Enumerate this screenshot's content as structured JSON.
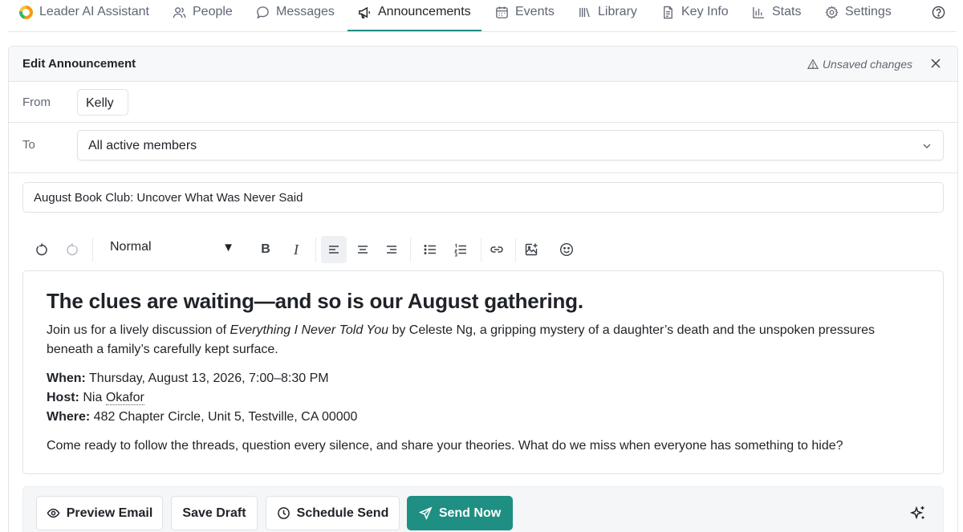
{
  "nav": {
    "brand": "Leader AI Assistant",
    "items": [
      {
        "label": "People",
        "icon": "people-icon"
      },
      {
        "label": "Messages",
        "icon": "message-bubble-icon"
      },
      {
        "label": "Announcements",
        "icon": "megaphone-icon"
      },
      {
        "label": "Events",
        "icon": "calendar-icon"
      },
      {
        "label": "Library",
        "icon": "library-icon"
      },
      {
        "label": "Key Info",
        "icon": "document-icon"
      },
      {
        "label": "Stats",
        "icon": "bar-chart-icon"
      },
      {
        "label": "Settings",
        "icon": "gear-icon"
      }
    ],
    "active": "Announcements",
    "accent_color": "#1e8f82"
  },
  "panel": {
    "title": "Edit Announcement",
    "status": "Unsaved changes"
  },
  "form": {
    "from_label": "From",
    "from_value": "Kelly",
    "to_label": "To",
    "to_value": "All active members",
    "subject": "August Book Club: Uncover What Was Never Said"
  },
  "toolbar": {
    "style_value": "Normal",
    "bold": "B",
    "italic": "I"
  },
  "editor": {
    "heading": "The clues are waiting—and so is our August gathering.",
    "intro_pre": "Join us for a lively discussion of ",
    "book_title": "Everything I Never Told You",
    "intro_post": " by Celeste Ng, a gripping mystery of a daughter’s death and the unspoken pressures beneath a family’s carefully kept surface.",
    "when_label": "When:",
    "when_value": " Thursday, August 13, 2026, 7:00–8:30 PM",
    "host_label": "Host:",
    "host_first": "Nia",
    "host_last": "Okafor",
    "where_label": "Where:",
    "where_value": " 482 Chapter Circle, Unit 5, Testville, CA 00000",
    "closing": "Come ready to follow the threads, question every silence, and share your theories. What do we miss when everyone has something to hide?"
  },
  "actions": {
    "preview": "Preview Email",
    "save_draft": "Save Draft",
    "schedule": "Schedule Send",
    "send_now": "Send Now"
  }
}
